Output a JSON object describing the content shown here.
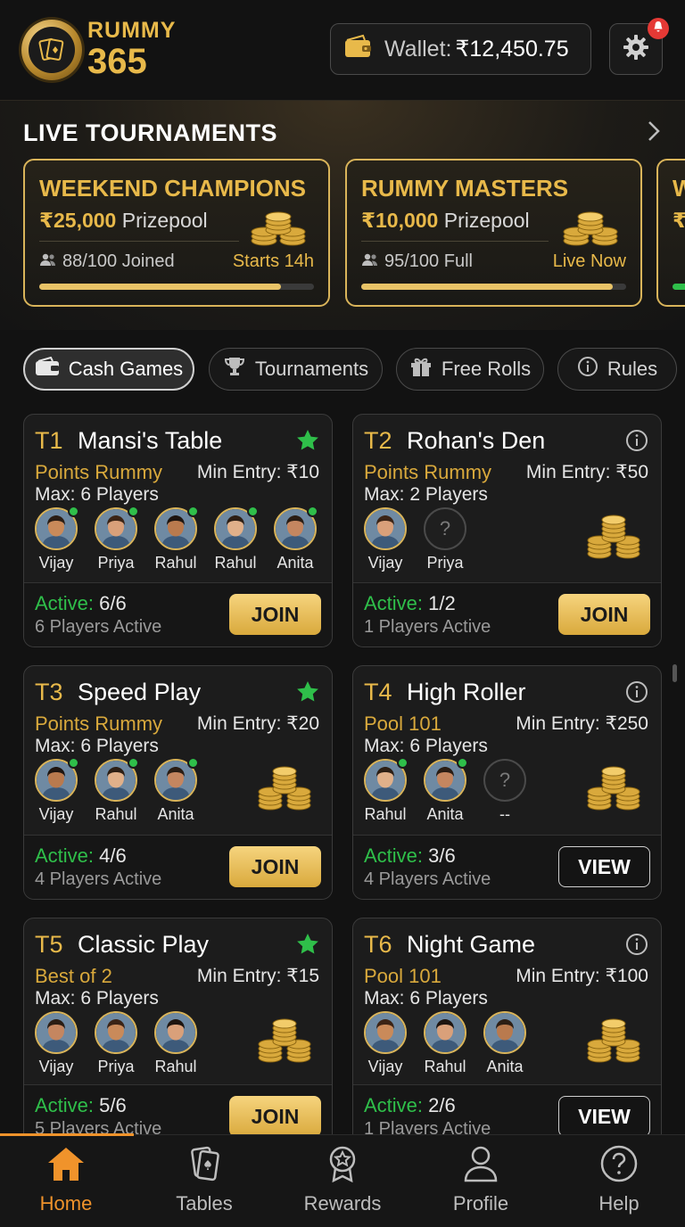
{
  "header": {
    "brand_line1": "RUMMY",
    "brand_line2": "365",
    "wallet_label": "Wallet:",
    "wallet_amount": "₹12,450.75",
    "settings_icon": "gear-icon",
    "notification": "bell-icon",
    "accent_color": "#e8b94a"
  },
  "live": {
    "title": "LIVE TOURNAMENTS",
    "tournaments": [
      {
        "name": "WEEKEND CHAMPIONS",
        "prize": "₹25,000",
        "prize_label": "Prizepool",
        "joined": "88/100 Joined",
        "status": "Starts 14h",
        "progress": 0.88
      },
      {
        "name": "RUMMY MASTERS",
        "prize": "₹10,000",
        "prize_label": "Prizepool",
        "joined": "95/100 Full",
        "status": "Live Now",
        "progress": 0.95
      },
      {
        "name": "W",
        "prize": "₹",
        "prize_label": "",
        "joined": "",
        "status": "",
        "progress": 0.3
      }
    ]
  },
  "filters": [
    {
      "label": "Cash Games",
      "icon": "cash-icon",
      "active": true
    },
    {
      "label": "Tournaments",
      "icon": "trophy-icon",
      "active": false
    },
    {
      "label": "Free Rolls",
      "icon": "gift-icon",
      "active": false
    },
    {
      "label": "Rules",
      "icon": "info-icon",
      "active": false
    }
  ],
  "tables": [
    {
      "id": "T1",
      "name": "Mansi's Table",
      "type": "Points Rummy",
      "min_entry": "Min Entry: ₹10",
      "max": "Max: 6 Players",
      "players": [
        {
          "n": "Vijay",
          "on": true
        },
        {
          "n": "Priya",
          "on": true
        },
        {
          "n": "Rahul",
          "on": true
        },
        {
          "n": "Rahul",
          "on": true
        },
        {
          "n": "Anita",
          "on": true
        }
      ],
      "active_label": "Active:",
      "active": "6/6",
      "sub": "6 Players Active",
      "action": "JOIN",
      "corner": "star"
    },
    {
      "id": "T2",
      "name": "Rohan's Den",
      "type": "Points Rummy",
      "min_entry": "Min Entry: ₹50",
      "max": "Max: 2 Players",
      "players": [
        {
          "n": "Vijay",
          "on": false
        },
        {
          "n": "Priya",
          "on": false,
          "empty": true
        }
      ],
      "active_label": "Active:",
      "active": "1/2",
      "sub": "1 Players Active",
      "action": "JOIN",
      "corner": "info"
    },
    {
      "id": "T3",
      "name": "Speed Play",
      "type": "Points Rummy",
      "min_entry": "Min Entry: ₹20",
      "max": "Max: 6 Players",
      "players": [
        {
          "n": "Vijay",
          "on": true
        },
        {
          "n": "Rahul",
          "on": true
        },
        {
          "n": "Anita",
          "on": true
        }
      ],
      "active_label": "Active:",
      "active": "4/6",
      "sub": "4 Players Active",
      "action": "JOIN",
      "corner": "star"
    },
    {
      "id": "T4",
      "name": "High Roller",
      "type": "Pool 101",
      "min_entry": "Min Entry: ₹250",
      "max": "Max: 6 Players",
      "players": [
        {
          "n": "Rahul",
          "on": true
        },
        {
          "n": "Anita",
          "on": true
        },
        {
          "n": "--",
          "on": false,
          "empty": true
        }
      ],
      "active_label": "Active:",
      "active": "3/6",
      "sub": "4 Players Active",
      "action": "VIEW",
      "corner": "info"
    },
    {
      "id": "T5",
      "name": "Classic Play",
      "type": "Best of 2",
      "min_entry": "Min Entry: ₹15",
      "max": "Max: 6 Players",
      "players": [
        {
          "n": "Vijay",
          "on": false
        },
        {
          "n": "Priya",
          "on": false
        },
        {
          "n": "Rahul",
          "on": false
        }
      ],
      "active_label": "Active:",
      "active": "5/6",
      "sub": "5 Players Active",
      "action": "JOIN",
      "corner": "star"
    },
    {
      "id": "T6",
      "name": "Night Game",
      "type": "Pool 101",
      "min_entry": "Min Entry: ₹100",
      "max": "Max: 6 Players",
      "players": [
        {
          "n": "Vijay",
          "on": false
        },
        {
          "n": "Rahul",
          "on": false
        },
        {
          "n": "Anita",
          "on": false
        }
      ],
      "active_label": "Active:",
      "active": "2/6",
      "sub": "1 Players Active",
      "action": "VIEW",
      "corner": "info"
    }
  ],
  "nav": [
    {
      "label": "Home",
      "icon": "home-icon",
      "active": true
    },
    {
      "label": "Tables",
      "icon": "cards-icon",
      "active": false
    },
    {
      "label": "Rewards",
      "icon": "medal-icon",
      "active": false
    },
    {
      "label": "Profile",
      "icon": "user-icon",
      "active": false
    },
    {
      "label": "Help",
      "icon": "help-icon",
      "active": false
    }
  ]
}
